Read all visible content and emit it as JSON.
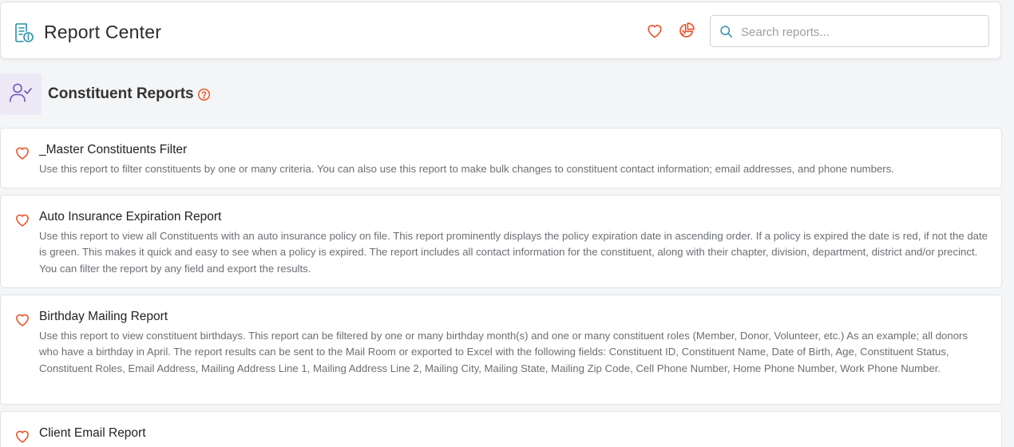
{
  "header": {
    "title": "Report Center",
    "logo_icon": "report-info-icon",
    "favorites_icon": "heart-outline-icon",
    "chart_icon": "pie-chart-icon",
    "search": {
      "placeholder": "Search reports...",
      "value": ""
    }
  },
  "section": {
    "title": "Constituent Reports",
    "icon": "user-check-icon",
    "help_icon": "question-circle-icon"
  },
  "colors": {
    "accent": "#e8552a",
    "teal": "#2a8fa8",
    "purple": "#6b58b5",
    "section_bg": "#ece8f6"
  },
  "reports": [
    {
      "title": "_Master Constituents Filter",
      "description": "Use this report to filter constituents by one or many criteria. You can also use this report to make bulk changes to constituent contact information; email addresses, and phone numbers."
    },
    {
      "title": "Auto Insurance Expiration Report",
      "description": "Use this report to view all Constituents with an auto insurance policy on file. This report prominently displays the policy expiration date in ascending order. If a policy is expired the date is red, if not the date is green. This makes it quick and easy to see when a policy is expired. The report includes all contact information for the constituent, along with their chapter, division, department, district and/or precinct. You can filter the report by any field and export the results."
    },
    {
      "title": "Birthday Mailing Report",
      "description": "Use this report to view constituent birthdays. This report can be filtered by one or many birthday month(s) and one or many constituent roles (Member, Donor, Volunteer, etc.) As an example; all donors who have a birthday in April. The report results can be sent to the Mail Room or exported to Excel with the following fields: Constituent ID, Constituent Name, Date of Birth, Age, Constituent Status, Constituent Roles, Email Address, Mailing Address Line 1, Mailing Address Line 2, Mailing City, Mailing State, Mailing Zip Code, Cell Phone Number, Home Phone Number, Work Phone Number."
    },
    {
      "title": "Client Email Report",
      "description": ""
    }
  ]
}
